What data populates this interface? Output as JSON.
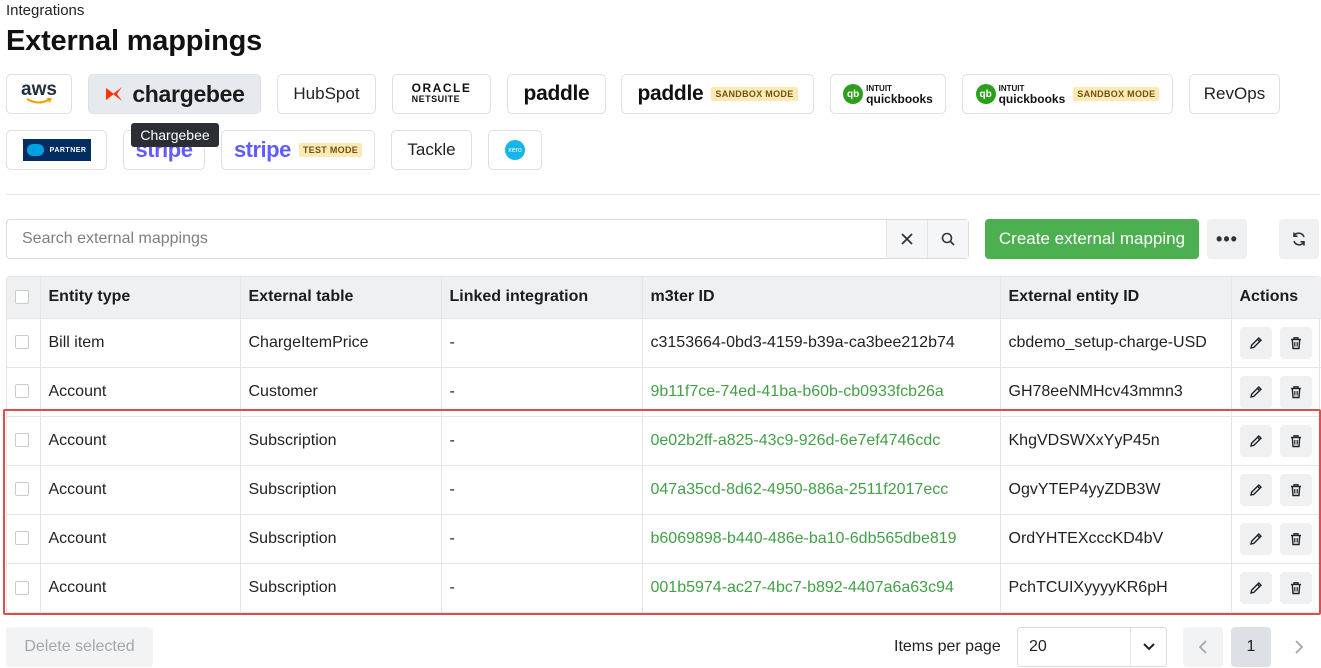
{
  "header": {
    "breadcrumb": "Integrations",
    "title": "External mappings"
  },
  "integrations": {
    "aws": "aws",
    "chargebee": "chargebee",
    "hubspot": "HubSpot",
    "oracle_top": "ORACLE",
    "oracle_bottom": "NETSUITE",
    "paddle": "paddle",
    "paddle_sandbox": "paddle",
    "paddle_sandbox_badge": "SANDBOX MODE",
    "qb_intuit": "INTUIT",
    "qb_name": "quickbooks",
    "qb_sandbox_intuit": "INTUIT",
    "qb_sandbox_name": "quickbooks",
    "qb_sandbox_badge": "SANDBOX MODE",
    "revops": "RevOps",
    "salesforce_partner": "PARTNER",
    "stripe": "stripe",
    "stripe_test": "stripe",
    "stripe_test_badge": "TEST MODE",
    "tackle": "Tackle",
    "xero": "xero",
    "tooltip": "Chargebee"
  },
  "toolbar": {
    "search_placeholder": "Search external mappings",
    "create_label": "Create external mapping",
    "more_label": "•••"
  },
  "table": {
    "columns": [
      "Entity type",
      "External table",
      "Linked integration",
      "m3ter ID",
      "External entity ID",
      "Actions"
    ],
    "rows": [
      {
        "entity_type": "Bill item",
        "external_table": "ChargeItemPrice",
        "linked": "-",
        "m3ter_id": "c3153664-0bd3-4159-b39a-ca3bee212b74",
        "m3ter_linked": false,
        "external_id": "cbdemo_setup-charge-USD"
      },
      {
        "entity_type": "Account",
        "external_table": "Customer",
        "linked": "-",
        "m3ter_id": "9b11f7ce-74ed-41ba-b60b-cb0933fcb26a",
        "m3ter_linked": true,
        "external_id": "GH78eeNMHcv43mmn3"
      },
      {
        "entity_type": "Account",
        "external_table": "Subscription",
        "linked": "-",
        "m3ter_id": "0e02b2ff-a825-43c9-926d-6e7ef4746cdc",
        "m3ter_linked": true,
        "external_id": "KhgVDSWXxYyP45n"
      },
      {
        "entity_type": "Account",
        "external_table": "Subscription",
        "linked": "-",
        "m3ter_id": "047a35cd-8d62-4950-886a-2511f2017ecc",
        "m3ter_linked": true,
        "external_id": "OgvYTEP4yyZDB3W"
      },
      {
        "entity_type": "Account",
        "external_table": "Subscription",
        "linked": "-",
        "m3ter_id": "b6069898-b440-486e-ba10-6db565dbe819",
        "m3ter_linked": true,
        "external_id": "OrdYHTEXcccKD4bV"
      },
      {
        "entity_type": "Account",
        "external_table": "Subscription",
        "linked": "-",
        "m3ter_id": "001b5974-ac27-4bc7-b892-4407a6a63c94",
        "m3ter_linked": true,
        "external_id": "PchTCUIXyyyyKR6pH"
      }
    ]
  },
  "footer": {
    "delete_label": "Delete selected",
    "items_per_page_label": "Items per page",
    "items_per_page_value": "20",
    "current_page": "1"
  },
  "colors": {
    "accent_green": "#4caf50",
    "link_green": "#43a047",
    "highlight_red": "#e04c4c"
  }
}
